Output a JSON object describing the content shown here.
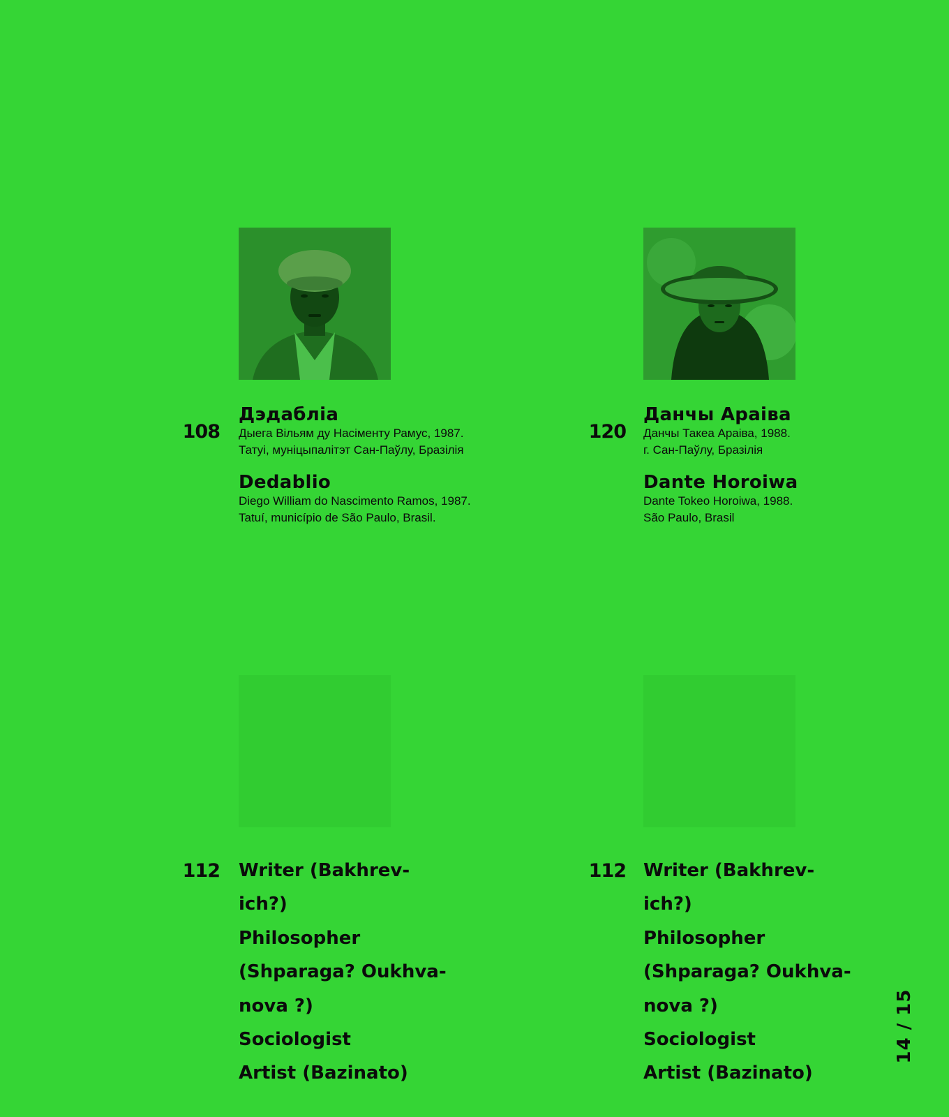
{
  "people": [
    {
      "number": "108",
      "name_be": "Дэдабліа",
      "info_be": [
        "Дыега Вільям ду Насіменту Рамус, 1987.",
        "Татуі, муніцыпалітэт Сан-Паўлу, Бразілія"
      ],
      "name_en": "Dedablio",
      "info_en": [
        "Diego William do Nascimento Ramos, 1987.",
        "Tatuí, município de São Paulo, Brasil."
      ]
    },
    {
      "number": "120",
      "name_be": "Данчы Араіва",
      "info_be": [
        "Данчы Такеа Араіва, 1988.",
        "г. Сан-Паўлу, Бразілія"
      ],
      "name_en": "Dante Horoiwa",
      "info_en": [
        "Dante Tokeo Horoiwa, 1988.",
        "São Paulo, Brasil"
      ]
    }
  ],
  "roles_blocks": [
    {
      "number": "112",
      "lines": [
        "Writer (Bakhrev-",
        "ich?)",
        "Philosopher",
        "(Shparaga? Oukhva-",
        "nova ?)",
        "Sociologist",
        "Artist (Bazinato)"
      ]
    },
    {
      "number": "112",
      "lines": [
        "Writer (Bakhrev-",
        "ich?)",
        "Philosopher",
        "(Shparaga? Oukhva-",
        "nova ?)",
        "Sociologist",
        "Artist (Bazinato)"
      ]
    }
  ],
  "page_indicator": "14 / 15",
  "colors": {
    "background": "#35d535",
    "text": "#0b0b0b"
  }
}
